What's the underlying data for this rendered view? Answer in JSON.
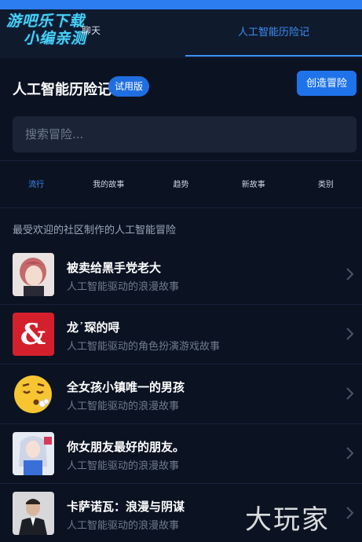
{
  "watermark": {
    "line1": "游吧乐下载",
    "line2": "小编亲测"
  },
  "header": {
    "left_tab": "聊天",
    "right_tab": "人工智能历险记"
  },
  "app": {
    "title": "人工智能历险记",
    "badge": "试用版",
    "create_button": "创造冒险"
  },
  "search": {
    "placeholder": "搜索冒险..."
  },
  "tabs": [
    "流行",
    "我的故事",
    "趋势",
    "新故事",
    "类别"
  ],
  "section_title": "最受欢迎的社区制作的人工智能冒险",
  "stories": [
    {
      "title": "被卖给黑手党老大",
      "subtitle": "人工智能驱动的浪漫故事"
    },
    {
      "title": "龙᾽琛的㖊",
      "subtitle": "人工智能驱动的角色扮演游戏故事"
    },
    {
      "title": "全女孩小镇唯一的男孩",
      "subtitle": "人工智能驱动的浪漫故事"
    },
    {
      "title": "你女朋友最好的朋友。",
      "subtitle": "人工智能驱动的浪漫故事"
    },
    {
      "title": "卡萨诺瓦：浪漫与阴谋",
      "subtitle": "人工智能驱动的浪漫故事"
    }
  ],
  "bottom_watermark": "大玩家",
  "colors": {
    "accent": "#3b8ff5",
    "button": "#1f73ea",
    "background": "#0b1322"
  }
}
